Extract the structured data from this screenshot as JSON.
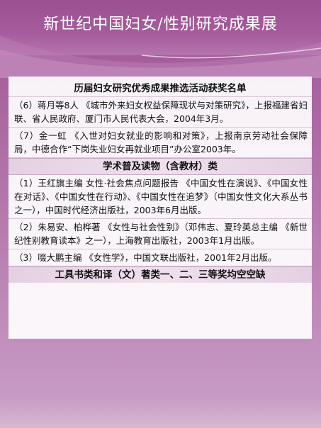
{
  "slide": {
    "title": "新世纪中国妇女/性别研究成果展"
  },
  "sections": {
    "award_list_title": "历届妇女研究优秀成果推选活动获奖名单",
    "award_items": [
      "（6）蒋月等8人 《城市外来妇女权益保障现状与对策研究》，上报福建省妇联、省人民政府、厦门市人民代表大会，2004年3月。",
      "（7）金一虹 《入世对妇女就业的影响和对策》，上报南京劳动社会保障局，中德合作“下岗失业妇女再就业项目”办公室2003年。"
    ],
    "popular_title": "学术普及读物（含教材）类",
    "popular_items": [
      "（1）王红旗主编 女性·社会焦点问题报告 《中国女性在演说》、《中国女性在对话》、《中国女性在行动》、《中国女性在追梦》（中国女性文化大系丛书之一），中国时代经济出版社，2003年6月出版。",
      "（2）朱易安、柏桦著 《女性与社会性别》（邓伟志、夏玲英总主编 《新世纪性别教育读本》之一），上海教育出版社，2003年1月出版。",
      "（3）啜大鹏主编 《女性学》，中国文联出版社，2001年2月出版。"
    ],
    "tools_title": "工具书类和译（文）著类一、二、三等奖均空空缺"
  }
}
